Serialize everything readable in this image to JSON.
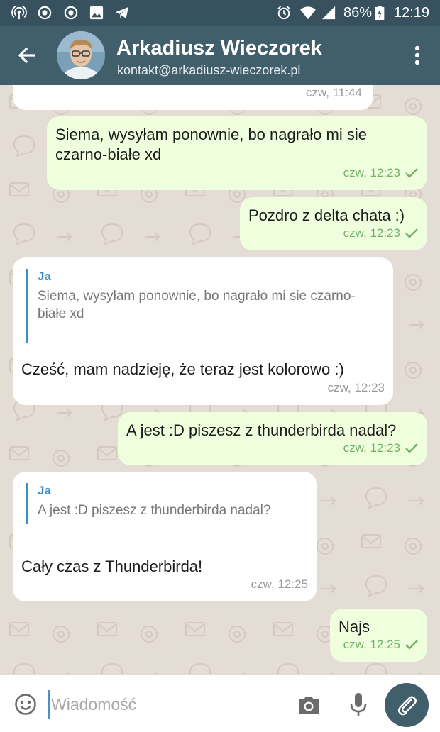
{
  "status_bar": {
    "battery": "86%",
    "time": "12:19"
  },
  "header": {
    "title": "Arkadiusz Wieczorek",
    "subtitle": "kontakt@arkadiusz-wieczorek.pl"
  },
  "messages": [
    {
      "direction": "incoming",
      "time": "czw, 11:44"
    },
    {
      "direction": "outgoing",
      "text": "Siema, wysyłam ponownie, bo nagrało mi sie czarno-białe xd",
      "time": "czw, 12:23",
      "delivered": true
    },
    {
      "direction": "outgoing",
      "text": "Pozdro z delta chata :)",
      "time": "czw, 12:23",
      "delivered": true
    },
    {
      "direction": "incoming",
      "quote": {
        "author": "Ja",
        "text": "Siema, wysyłam ponownie, bo nagrało mi sie czarno-białe xd"
      },
      "text": "Cześć, mam nadzieję, że teraz jest kolorowo :)",
      "time": "czw, 12:23"
    },
    {
      "direction": "outgoing",
      "text": "A jest :D piszesz z thunderbirda nadal?",
      "time": "czw, 12:23",
      "delivered": true
    },
    {
      "direction": "incoming",
      "quote": {
        "author": "Ja",
        "text": "A jest :D piszesz z thunderbirda nadal?"
      },
      "text": "Cały czas z Thunderbirda!",
      "time": "czw, 12:25"
    },
    {
      "direction": "outgoing",
      "text": "Najs",
      "time": "czw, 12:25",
      "delivered": true
    }
  ],
  "composer": {
    "placeholder": "Wiadomość",
    "value": ""
  },
  "colors": {
    "toolbar": "#415e6b",
    "status_bar": "#37525e",
    "chat_background": "#e4ddd5",
    "outgoing_bubble": "#efffde",
    "incoming_bubble": "#ffffff",
    "quote_accent": "#3b8fc2",
    "delivered_check": "#74b06a"
  },
  "icons": [
    "wifi-hotspot-icon",
    "record-icon",
    "record-icon",
    "image-icon",
    "telegram-icon",
    "alarm-icon",
    "wifi-icon",
    "signal-icon",
    "battery-icon",
    "back-arrow-icon",
    "overflow-menu-icon",
    "check-icon",
    "emoji-icon",
    "camera-icon",
    "microphone-icon",
    "paperclip-icon"
  ]
}
